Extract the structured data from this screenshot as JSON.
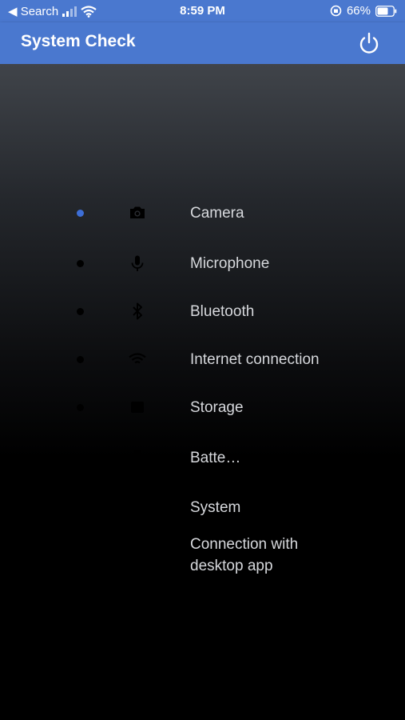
{
  "status_bar": {
    "back_label": "◀ Search",
    "time": "8:59 PM",
    "battery": "66%"
  },
  "app_bar": {
    "title": "System Check",
    "power_icon": "power-icon"
  },
  "checks": [
    {
      "label": "Camera",
      "icon": "camera-icon",
      "dot_color": "#3d6ed6"
    },
    {
      "label": "Microphone",
      "icon": "microphone-icon",
      "dot_color": "#000000"
    },
    {
      "label": "Bluetooth",
      "icon": "bluetooth-icon",
      "dot_color": "#000000"
    },
    {
      "label": "Internet connection",
      "icon": "wifi-icon",
      "dot_color": "#000000"
    },
    {
      "label": "Storage",
      "icon": "storage-icon",
      "dot_color": "#000000"
    },
    {
      "label": "Batte…",
      "icon": "battery-icon",
      "dot_color": "#000000"
    },
    {
      "label": "System",
      "icon": "system-icon",
      "dot_color": "#000000"
    },
    {
      "label": "Connection with\ndesktop app",
      "icon": "desktop-icon",
      "dot_color": "#000000"
    }
  ],
  "colors": {
    "app_bar": "#4a78cf",
    "active_dot": "#3d6ed6",
    "label_text": "#d6d8dc"
  }
}
